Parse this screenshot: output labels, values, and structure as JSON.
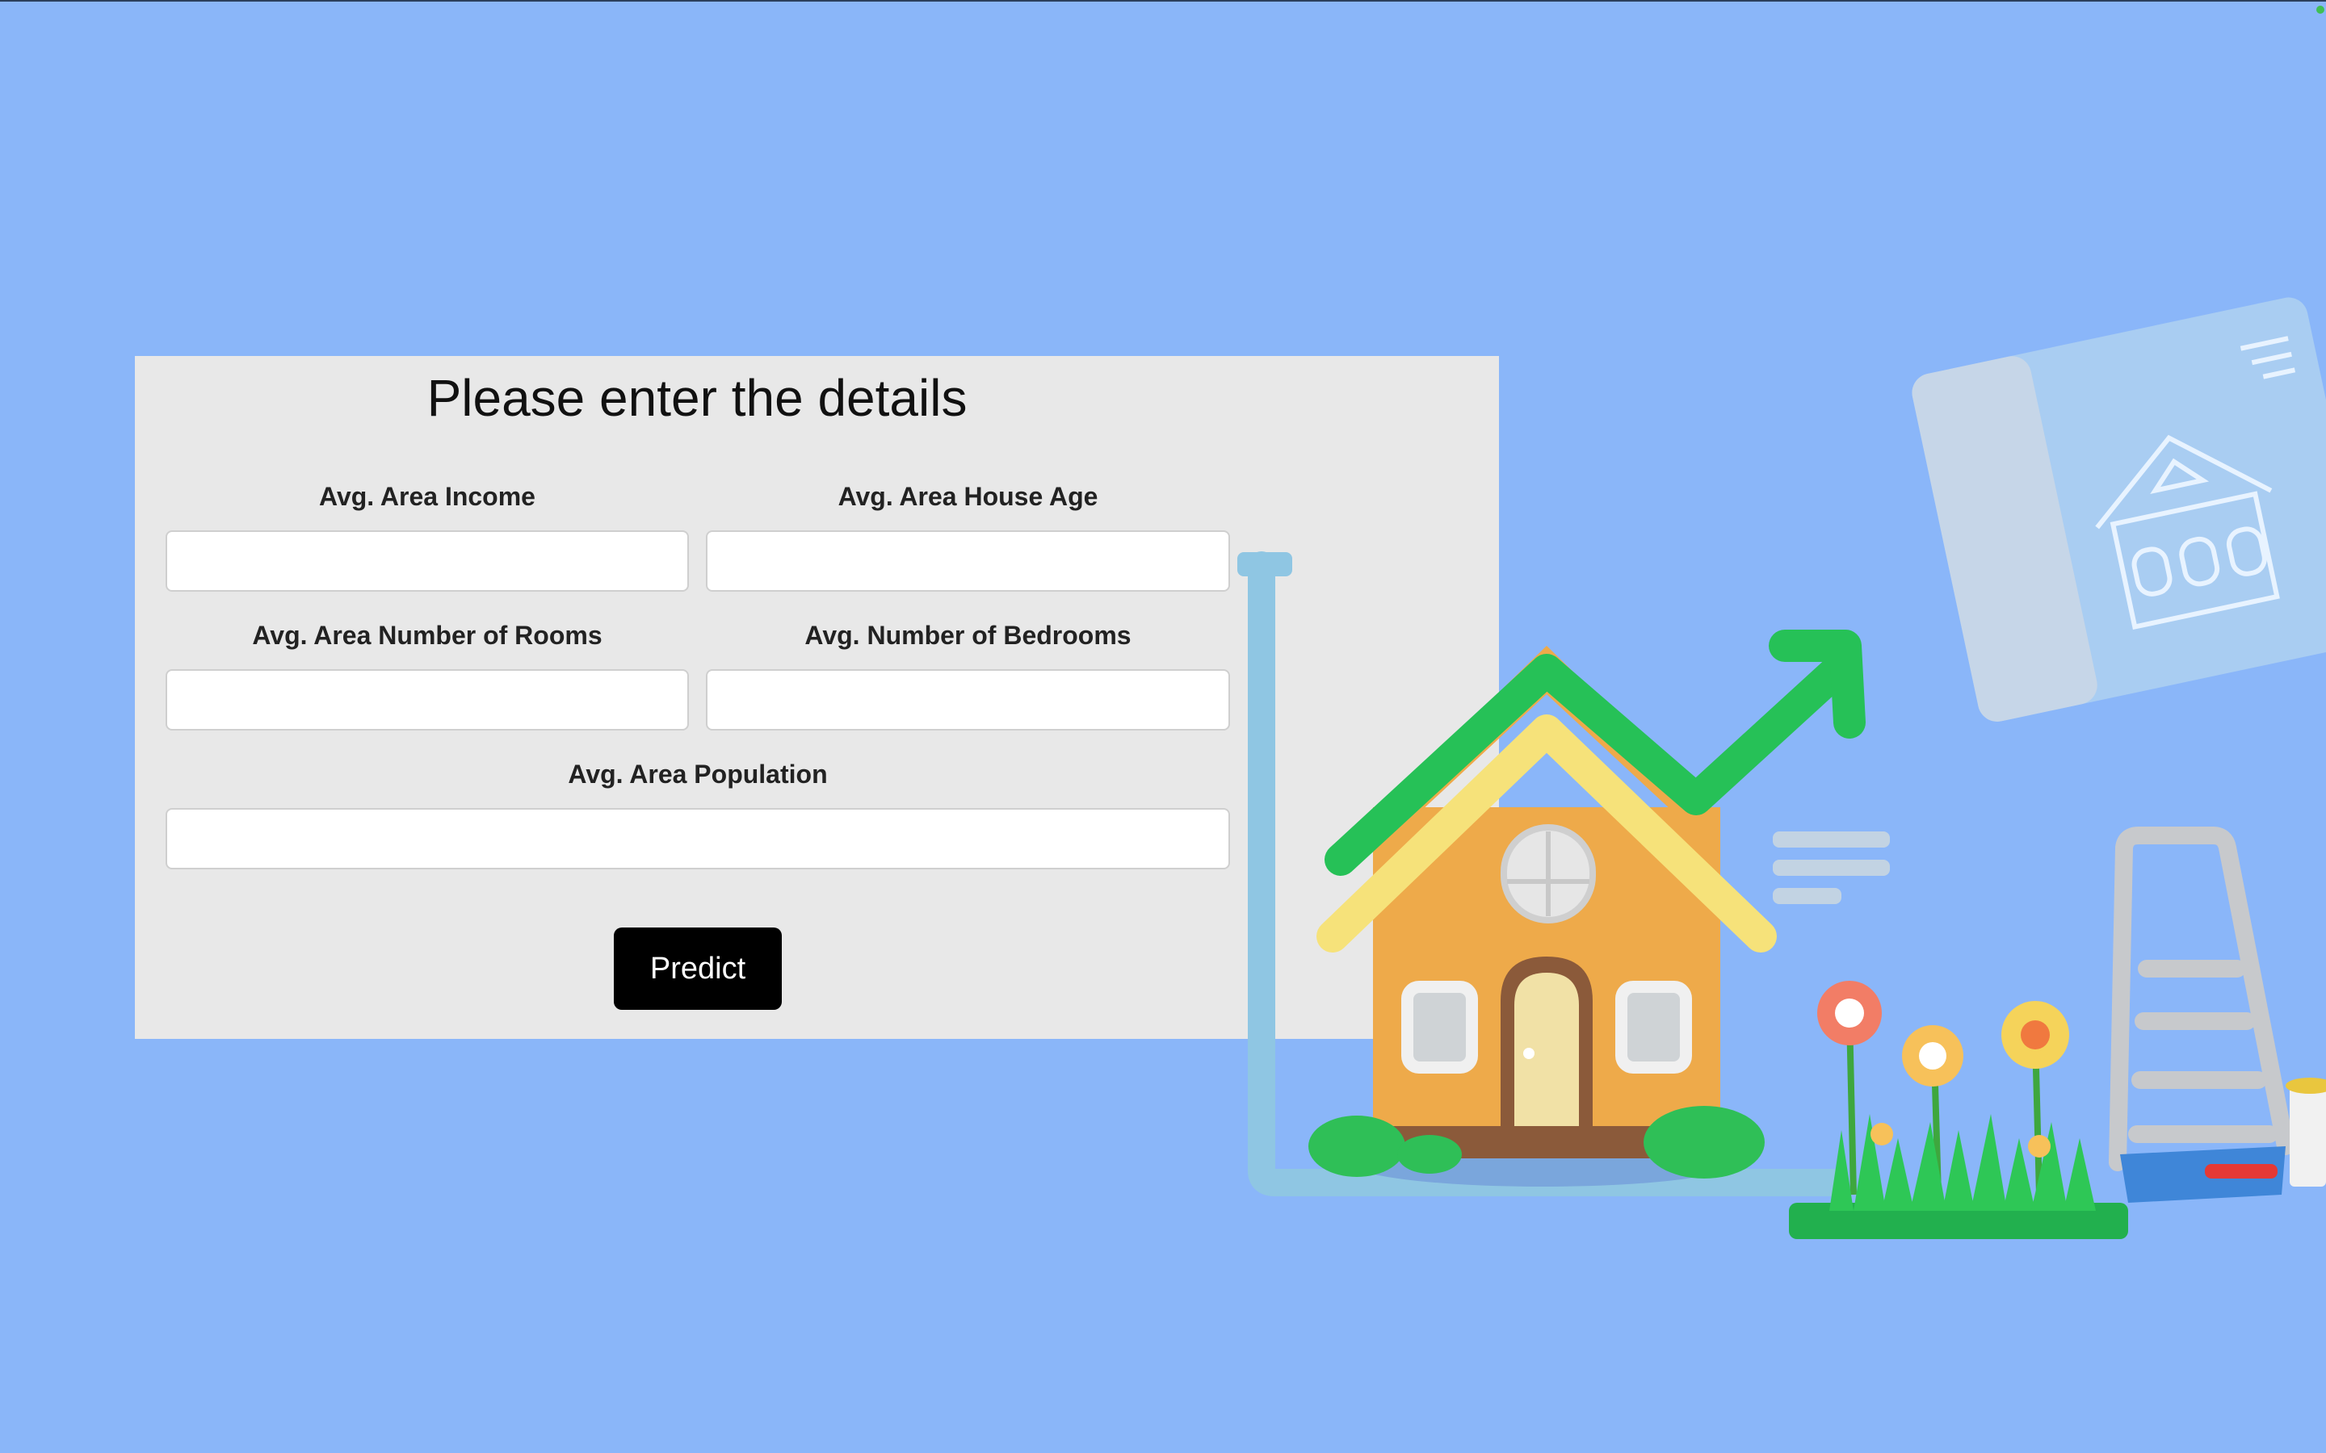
{
  "form": {
    "title": "Please enter the details",
    "fields": {
      "income": {
        "label": "Avg. Area Income",
        "value": "",
        "placeholder": ""
      },
      "house_age": {
        "label": "Avg. Area House Age",
        "value": "",
        "placeholder": ""
      },
      "rooms": {
        "label": "Avg. Area Number of Rooms",
        "value": "",
        "placeholder": ""
      },
      "bedrooms": {
        "label": "Avg. Number of Bedrooms",
        "value": "",
        "placeholder": ""
      },
      "population": {
        "label": "Avg. Area Population",
        "value": "",
        "placeholder": ""
      }
    },
    "submit_label": "Predict"
  },
  "colors": {
    "background": "#8ab6f9",
    "card": "#e8e8e8",
    "button": "#000000",
    "arrow": "#2cc85a",
    "house": "#f2ad48",
    "roof": "#f6e27a"
  },
  "icons": [
    "house-illustration",
    "growth-arrow-icon",
    "blueprint-illustration",
    "flowers-illustration",
    "ladder-illustration",
    "paint-tray-illustration",
    "status-dot-icon"
  ]
}
